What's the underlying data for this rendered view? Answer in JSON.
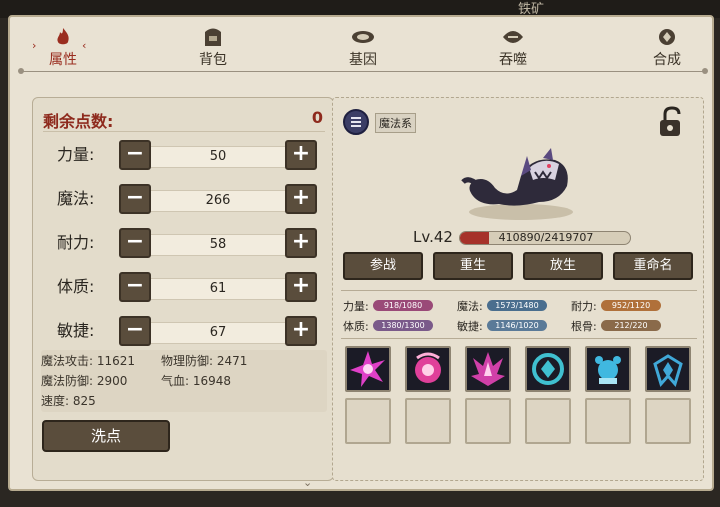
{
  "top_label": "铁矿",
  "tabs": [
    {
      "label": "属性",
      "icon": "flame-icon",
      "active": true
    },
    {
      "label": "背包",
      "icon": "backpack-icon"
    },
    {
      "label": "基因",
      "icon": "gene-icon"
    },
    {
      "label": "吞噬",
      "icon": "devour-icon"
    },
    {
      "label": "合成",
      "icon": "synthesis-icon"
    }
  ],
  "tab_arrows": {
    "left": "›",
    "right": "‹"
  },
  "left": {
    "points_label": "剩余点数:",
    "points_value": "0",
    "stats": [
      {
        "name": "力量:",
        "value": "50"
      },
      {
        "name": "魔法:",
        "value": "266"
      },
      {
        "name": "耐力:",
        "value": "58"
      },
      {
        "name": "体质:",
        "value": "61"
      },
      {
        "name": "敏捷:",
        "value": "67"
      }
    ],
    "minus_label": "−",
    "plus_label": "+",
    "derived": {
      "magic_attack": "魔法攻击: 11621",
      "phys_def": "物理防御: 2471",
      "magic_def": "魔法防御: 2900",
      "hp": "气血: 16948",
      "speed": "速度: 825"
    },
    "wash_button": "洗点",
    "scroll_mark": "⌄"
  },
  "right": {
    "type_label": "魔法系",
    "level": "Lv.42",
    "hp_text": "410890/2419707",
    "hp_fraction": 0.17,
    "actions": [
      "参战",
      "重生",
      "放生",
      "重命名"
    ],
    "attrs": [
      {
        "label": "力量:",
        "value": "918/1080",
        "color": "#9a4a78"
      },
      {
        "label": "魔法:",
        "value": "1573/1480",
        "color": "#4a6e8e"
      },
      {
        "label": "耐力:",
        "value": "952/1120",
        "color": "#b0703a"
      },
      {
        "label": "体质:",
        "value": "1380/1300",
        "color": "#7a5a8a"
      },
      {
        "label": "敏捷:",
        "value": "1146/1020",
        "color": "#5a7a98"
      },
      {
        "label": "根骨:",
        "value": "212/220",
        "color": "#8a6a4a"
      }
    ],
    "skills": [
      {
        "icon": "pink-burst-icon",
        "color": "#e040c8"
      },
      {
        "icon": "pink-orb-icon",
        "color": "#e0409a"
      },
      {
        "icon": "pink-flame-icon",
        "color": "#d040a8"
      },
      {
        "icon": "cyan-shield-icon",
        "color": "#40c0d0"
      },
      {
        "icon": "cyan-beast-icon",
        "color": "#40b8e0"
      },
      {
        "icon": "cyan-wing-icon",
        "color": "#40a8d8"
      }
    ],
    "empty_slots": 6
  }
}
